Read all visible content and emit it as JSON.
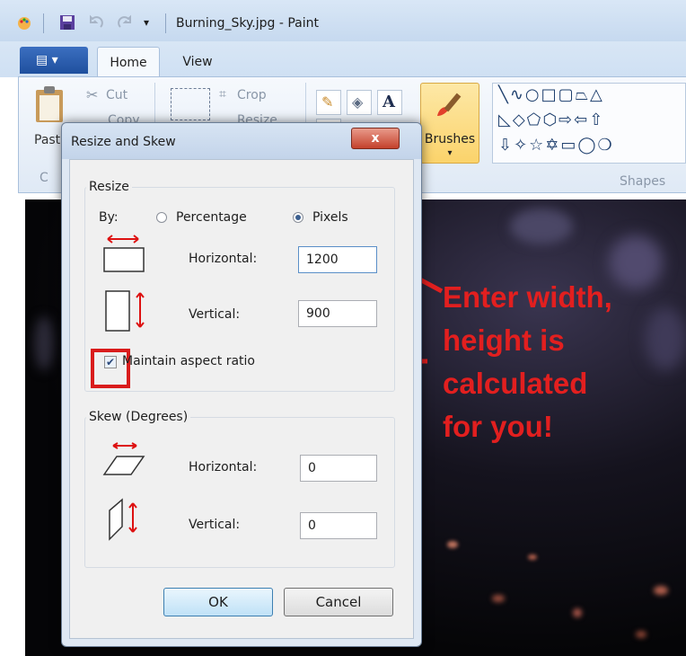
{
  "window": {
    "title": "Burning_Sky.jpg - Paint"
  },
  "ribbon": {
    "tabs": [
      "Home",
      "View"
    ],
    "clipboard": {
      "paste_label": "Past",
      "cut_label": "Cut",
      "copy_label": "Copy",
      "group_label": "C"
    },
    "image": {
      "crop_label": "Crop",
      "resize_label": "Resize"
    },
    "brushes_label": "Brushes",
    "shapes_label": "Shapes",
    "shape_rows": [
      "╲∿○□▢⏢△",
      "◺◇⬠⬡⇨⇦⇧",
      "⇩✧☆✡▭◯❍"
    ]
  },
  "dialog": {
    "title": "Resize and Skew",
    "close_label": "x",
    "resize": {
      "group_label": "Resize",
      "by_label": "By:",
      "percentage_label": "Percentage",
      "pixels_label": "Pixels",
      "selected_unit": "Pixels",
      "horizontal_label": "Horizontal:",
      "horizontal_value": "1200",
      "vertical_label": "Vertical:",
      "vertical_value": "900",
      "maintain_aspect_label": "Maintain aspect ratio",
      "maintain_aspect_checked": true
    },
    "skew": {
      "group_label": "Skew (Degrees)",
      "horizontal_label": "Horizontal:",
      "horizontal_value": "0",
      "vertical_label": "Vertical:",
      "vertical_value": "0"
    },
    "ok_label": "OK",
    "cancel_label": "Cancel"
  },
  "annotation": {
    "lines": [
      "Enter width,",
      "height is",
      "calculated",
      "for you!"
    ],
    "color": "#e21f1f"
  }
}
